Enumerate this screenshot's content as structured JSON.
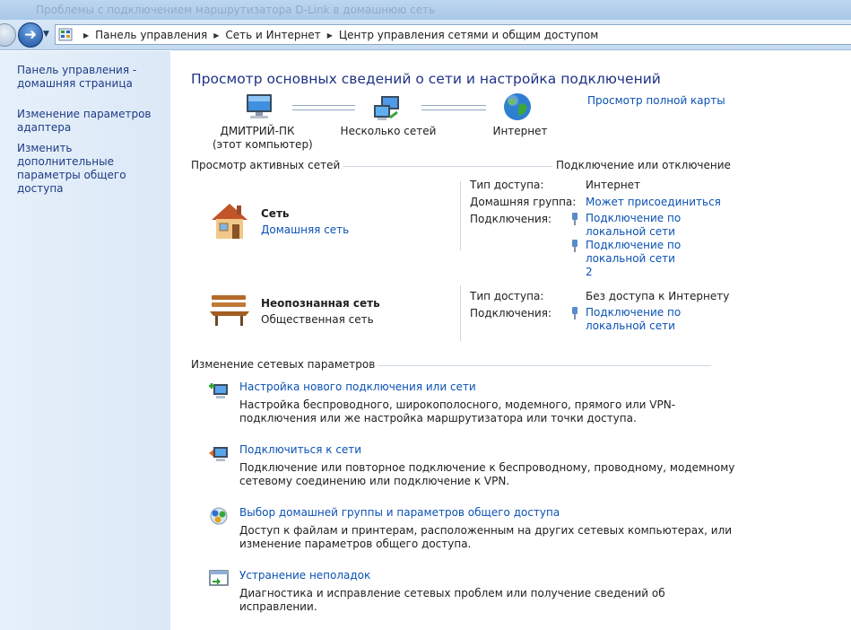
{
  "window": {
    "title": "Проблемы с подключением маршрутизатора D-Link в домашнюю сеть"
  },
  "breadcrumb": [
    "Панель управления",
    "Сеть и Интернет",
    "Центр управления сетями и общим доступом"
  ],
  "sidebar": {
    "items": [
      {
        "label": "Панель управления - домашняя страница"
      },
      {
        "label": "Изменение параметров адаптера"
      },
      {
        "label": "Изменить дополнительные параметры общего доступа"
      }
    ]
  },
  "main": {
    "title": "Просмотр основных сведений о сети и настройка подключений",
    "full_map_link": "Просмотр полной карты",
    "map": {
      "computer_name": "ДМИТРИЙ-ПК",
      "computer_sub": "(этот компьютер)",
      "middle": "Несколько сетей",
      "internet": "Интернет"
    },
    "active_heading": "Просмотр активных сетей",
    "connect_link": "Подключение или отключение",
    "networks": [
      {
        "name": "Сеть",
        "type": "Домашняя сеть",
        "access_label": "Тип доступа:",
        "access_value": "Интернет",
        "homegroup_label": "Домашняя группа:",
        "homegroup_value": "Может присоединиться",
        "connections_label": "Подключения:",
        "connections": [
          "Подключение по локальной сети",
          "Подключение по локальной сети 2"
        ]
      },
      {
        "name": "Неопознанная сеть",
        "type": "Общественная сеть",
        "access_label": "Тип доступа:",
        "access_value": "Без доступа к Интернету",
        "connections_label": "Подключения:",
        "connections": [
          "Подключение по локальной сети"
        ]
      }
    ],
    "change_heading": "Изменение сетевых параметров",
    "tasks": [
      {
        "title": "Настройка нового подключения или сети",
        "desc": "Настройка беспроводного, широкополосного, модемного, прямого или VPN-подключения или же настройка маршрутизатора или точки доступа.",
        "icon": "new-connection-icon"
      },
      {
        "title": "Подключиться к сети",
        "desc": "Подключение или повторное подключение к беспроводному, проводному, модемному сетевому соединению или подключение к VPN.",
        "icon": "connect-network-icon"
      },
      {
        "title": "Выбор домашней группы и параметров общего доступа",
        "desc": "Доступ к файлам и принтерам, расположенным на других сетевых компьютерах, или изменение параметров общего доступа.",
        "icon": "homegroup-icon"
      },
      {
        "title": "Устранение неполадок",
        "desc": "Диагностика и исправление сетевых проблем или получение сведений об исправлении.",
        "icon": "troubleshoot-icon"
      }
    ]
  },
  "colors": {
    "link": "#0b52b3",
    "title": "#1e3287",
    "sidebar_link": "#1e3b86"
  }
}
